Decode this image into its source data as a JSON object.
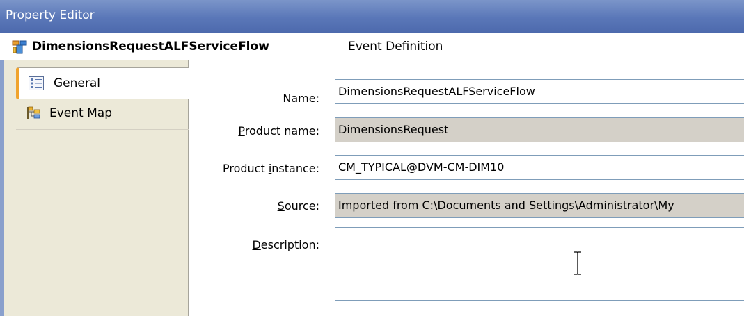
{
  "window": {
    "title": "Property Editor"
  },
  "header": {
    "title": "DimensionsRequestALFServiceFlow",
    "subtitle": "Event Definition",
    "icon": "flow-icon"
  },
  "sidebar": {
    "items": [
      {
        "label": "General",
        "icon": "property-list-icon",
        "active": true
      },
      {
        "label": "Event Map",
        "icon": "event-map-icon",
        "active": false
      }
    ]
  },
  "form": {
    "name": {
      "label_mnemonic": "N",
      "label_rest": "ame:",
      "value": "DimensionsRequestALFServiceFlow",
      "readonly": false
    },
    "product_name": {
      "label_mnemonic": "P",
      "label_rest": "roduct name:",
      "value": "DimensionsRequest",
      "readonly": true
    },
    "product_instance": {
      "label_pre": "Product ",
      "label_mnemonic": "i",
      "label_rest": "nstance:",
      "value": "CM_TYPICAL@DVM-CM-DIM10",
      "readonly": false
    },
    "source": {
      "label_mnemonic": "S",
      "label_rest": "ource:",
      "value": "Imported from C:\\Documents and Settings\\Administrator\\My",
      "readonly": true
    },
    "description": {
      "label_mnemonic": "D",
      "label_rest": "escription:",
      "value": "",
      "readonly": false
    }
  },
  "colors": {
    "titlebar": "#5a77b8",
    "sidebar_bg": "#ece9d8",
    "active_tab_accent": "#f0a32d",
    "readonly_field_bg": "#d4d0c8",
    "field_border": "#7f9db9"
  }
}
